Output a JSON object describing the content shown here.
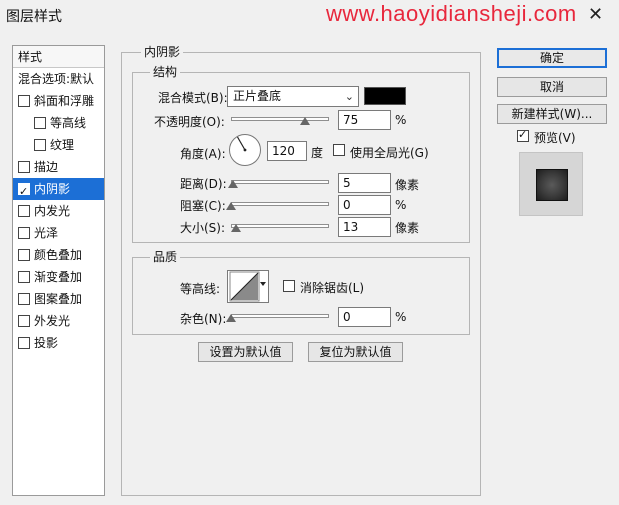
{
  "window": {
    "title": "图层样式",
    "watermark": "www.haoyidiansheji.com",
    "close_glyph": "✕"
  },
  "style_list": {
    "header": "样式",
    "items": [
      {
        "label": "混合选项:默认",
        "checkbox": false,
        "checked": false,
        "indent": false,
        "selected": false
      },
      {
        "label": "斜面和浮雕",
        "checkbox": true,
        "checked": false,
        "indent": false,
        "selected": false
      },
      {
        "label": "等高线",
        "checkbox": true,
        "checked": false,
        "indent": true,
        "selected": false
      },
      {
        "label": "纹理",
        "checkbox": true,
        "checked": false,
        "indent": true,
        "selected": false
      },
      {
        "label": "描边",
        "checkbox": true,
        "checked": false,
        "indent": false,
        "selected": false
      },
      {
        "label": "内阴影",
        "checkbox": true,
        "checked": true,
        "indent": false,
        "selected": true
      },
      {
        "label": "内发光",
        "checkbox": true,
        "checked": false,
        "indent": false,
        "selected": false
      },
      {
        "label": "光泽",
        "checkbox": true,
        "checked": false,
        "indent": false,
        "selected": false
      },
      {
        "label": "颜色叠加",
        "checkbox": true,
        "checked": false,
        "indent": false,
        "selected": false
      },
      {
        "label": "渐变叠加",
        "checkbox": true,
        "checked": false,
        "indent": false,
        "selected": false
      },
      {
        "label": "图案叠加",
        "checkbox": true,
        "checked": false,
        "indent": false,
        "selected": false
      },
      {
        "label": "外发光",
        "checkbox": true,
        "checked": false,
        "indent": false,
        "selected": false
      },
      {
        "label": "投影",
        "checkbox": true,
        "checked": false,
        "indent": false,
        "selected": false
      }
    ]
  },
  "panel": {
    "title": "内阴影",
    "structure": {
      "title": "结构",
      "blend_mode_label": "混合模式(B):",
      "blend_mode_value": "正片叠底",
      "blend_color": "#000000",
      "opacity_label": "不透明度(O):",
      "opacity_value": "75",
      "opacity_unit": "%",
      "opacity_level": 0.75,
      "angle_label": "角度(A):",
      "angle_value": "120",
      "angle_unit": "度",
      "global_light_label": "使用全局光(G)",
      "global_light_checked": false,
      "distance_label": "距离(D):",
      "distance_value": "5",
      "distance_unit": "像素",
      "distance_level": 0.02,
      "choke_label": "阻塞(C):",
      "choke_value": "0",
      "choke_unit": "%",
      "choke_level": 0.0,
      "size_label": "大小(S):",
      "size_value": "13",
      "size_unit": "像素",
      "size_level": 0.05
    },
    "quality": {
      "title": "品质",
      "contour_label": "等高线:",
      "anti_alias_label": "消除锯齿(L)",
      "anti_alias_checked": false,
      "noise_label": "杂色(N):",
      "noise_value": "0",
      "noise_unit": "%",
      "noise_level": 0.0
    },
    "set_default_label": "设置为默认值",
    "reset_default_label": "复位为默认值"
  },
  "buttons": {
    "ok": "确定",
    "cancel": "取消",
    "new_style": "新建样式(W)...",
    "preview_label": "预览(V)",
    "preview_checked": true
  }
}
